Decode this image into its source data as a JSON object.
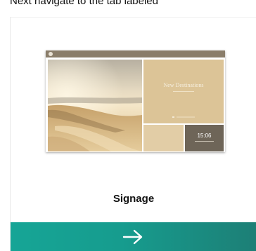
{
  "header": {
    "instruction": "Next navigate to the tab labeled"
  },
  "card": {
    "title": "Signage",
    "action_icon": "arrow-right-icon",
    "accent_color": "#16a596",
    "thumbnail": {
      "title": "New Destinations",
      "subtitle": "",
      "time": "15:06"
    }
  }
}
